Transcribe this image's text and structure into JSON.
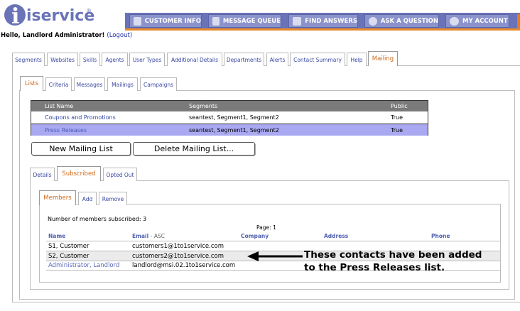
{
  "logo": {
    "text": "iservice",
    "reg": "®"
  },
  "nav": {
    "customer_info": "CUSTOMER INFO",
    "message_queue": "MESSAGE QUEUE",
    "find_answers": "FIND ANSWERS",
    "ask_question": "ASK A QUESTION",
    "my_account": "MY ACCOUNT"
  },
  "greeting": {
    "text": "Hello, Landlord Administrator!",
    "logout": "(Logout)"
  },
  "main_tabs": [
    "Segments",
    "Websites",
    "Skills",
    "Agents",
    "User Types",
    "Additional Details",
    "Departments",
    "Alerts",
    "Contact Summary",
    "Help",
    "Mailing"
  ],
  "mailing_tabs": [
    "Lists",
    "Criteria",
    "Messages",
    "Mailings",
    "Campaigns"
  ],
  "lists_table": {
    "headers": {
      "name": "List Name",
      "segments": "Segments",
      "public": "Public"
    },
    "rows": [
      {
        "name": "Coupons and Promotions",
        "segments": "seantest, Segment1, Segment2",
        "public": "True"
      },
      {
        "name": "Press Releases",
        "segments": "seantest, Segment1, Segment2",
        "public": "True"
      }
    ]
  },
  "buttons": {
    "new_list": "New Mailing List",
    "delete_list": "Delete Mailing List..."
  },
  "detail_tabs": [
    "Details",
    "Subscribed",
    "Opted Out"
  ],
  "member_tabs": [
    "Members",
    "Add",
    "Remove"
  ],
  "members": {
    "count_text": "Number of members subscribed: 3",
    "page_text": "Page: 1",
    "headers": {
      "name": "Name",
      "email": "Email",
      "email_sort": "- ASC",
      "company": "Company",
      "address": "Address",
      "phone": "Phone"
    },
    "rows": [
      {
        "name": "S1, Customer",
        "email": "customers1@1to1service.com"
      },
      {
        "name": "S2, Customer",
        "email": "customers2@1to1service.com"
      },
      {
        "name": "Administrator, Landlord",
        "email": "landlord@msi.02.1to1service.com"
      }
    ]
  },
  "callout": {
    "line1": "These contacts have been added",
    "line2": "to the Press Releases list."
  },
  "colors": {
    "nav": "#6a73b7",
    "accent": "#e8892a",
    "selected_row": "#a9a9f2",
    "link": "#2f46a8"
  }
}
